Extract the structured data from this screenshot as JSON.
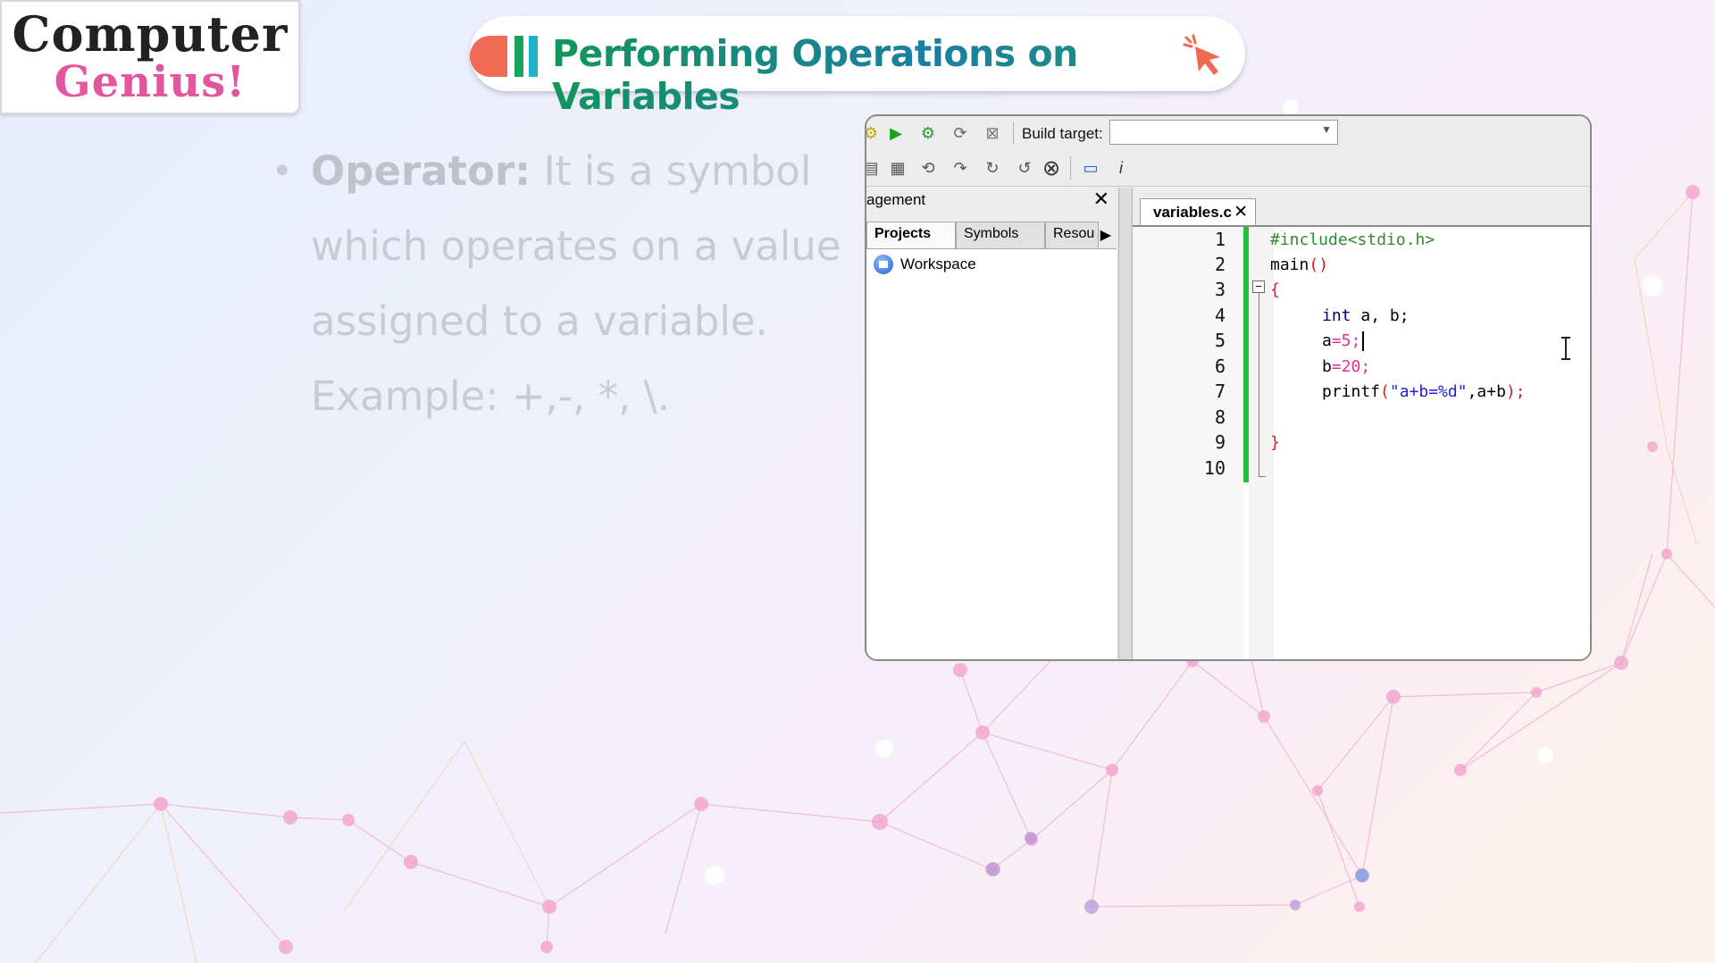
{
  "logo": {
    "line1": "Computer",
    "line2": "Genius!"
  },
  "header": {
    "title": "Performing Operations on Variables"
  },
  "bullet": {
    "term": "Operator:",
    "definition": " It is a symbol which operates on a value assigned to a variable. Example: +,-, *, \\."
  },
  "ide": {
    "build_target_label": "Build target:",
    "build_target_value": "",
    "management_title": "agement",
    "management_tabs": [
      "Projects",
      "Symbols",
      "Resou"
    ],
    "workspace_label": "Workspace",
    "file_tab": "variables.c",
    "line_numbers": [
      "1",
      "2",
      "3",
      "4",
      "5",
      "6",
      "7",
      "8",
      "9",
      "10"
    ],
    "code": [
      "#include<stdio.h>",
      "main()",
      "{",
      "int a, b;",
      "a=5;",
      "b=20;",
      "printf(\"a+b=%d\",a+b);",
      "",
      "}",
      ""
    ]
  },
  "colors": {
    "title_green": "#12955b",
    "title_blue": "#1c7ea2",
    "accent_orange": "#ee6a52",
    "logo_pink": "#e2559f",
    "gutter_green": "#22c03a"
  }
}
